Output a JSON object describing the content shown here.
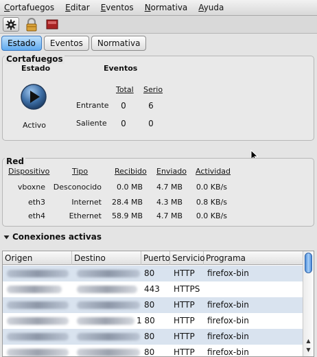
{
  "menu": [
    "Cortafuegos",
    "Editar",
    "Eventos",
    "Normativa",
    "Ayuda"
  ],
  "menu_underline": [
    "C",
    "E",
    "E",
    "N",
    "A"
  ],
  "menu_rest": [
    "ortafuegos",
    "ditar",
    "ventos",
    "ormativa",
    "yuda"
  ],
  "tabs": [
    "Estado",
    "Eventos",
    "Normativa"
  ],
  "firewall": {
    "title": "Cortafuegos",
    "state_label": "Estado",
    "events_label": "Eventos",
    "status": "Activo",
    "col_total": "Total",
    "col_serial": "Serio",
    "rows": [
      {
        "label": "Entrante",
        "total": "0",
        "serial": "6"
      },
      {
        "label": "Saliente",
        "total": "0",
        "serial": "0"
      }
    ]
  },
  "network": {
    "title": "Red",
    "headers": [
      "Dispositivo",
      "Tipo",
      "Recibido",
      "Enviado",
      "Actividad"
    ],
    "rows": [
      {
        "device": "vboxne",
        "type": "Desconocido",
        "received": "0.0 MB",
        "sent": "4.7 MB",
        "activity": "0.0 KB/s"
      },
      {
        "device": "eth3",
        "type": "Internet",
        "received": "28.4 MB",
        "sent": "4.3 MB",
        "activity": "0.8 KB/s"
      },
      {
        "device": "eth4",
        "type": "Ethernet",
        "received": "58.9 MB",
        "sent": "4.7 MB",
        "activity": "0.0 KB/s"
      }
    ]
  },
  "connections": {
    "title": "Conexiones activas",
    "headers": [
      "Origen",
      "Destino",
      "Puerto",
      "Servicio",
      "Programa"
    ],
    "rows": [
      {
        "port": "80",
        "service": "HTTP",
        "program": "firefox-bin"
      },
      {
        "port": "443",
        "service": "HTTPS",
        "program": ""
      },
      {
        "port": "80",
        "service": "HTTP",
        "program": "firefox-bin"
      },
      {
        "port": "1 80",
        "service": "HTTP",
        "program": "firefox-bin"
      },
      {
        "port": "80",
        "service": "HTTP",
        "program": "firefox-bin"
      },
      {
        "port": "80",
        "service": "HTTP",
        "program": "firefox-bin"
      }
    ]
  },
  "colors": {
    "active_tab": "#5fa9ee",
    "alt_row": "#d9e3ef",
    "play_button": "#2f5a8a"
  },
  "icons": [
    "gear-icon",
    "lock-icon",
    "stop-icon",
    "play-icon",
    "triangle-down-icon",
    "mouse-cursor-icon"
  ]
}
